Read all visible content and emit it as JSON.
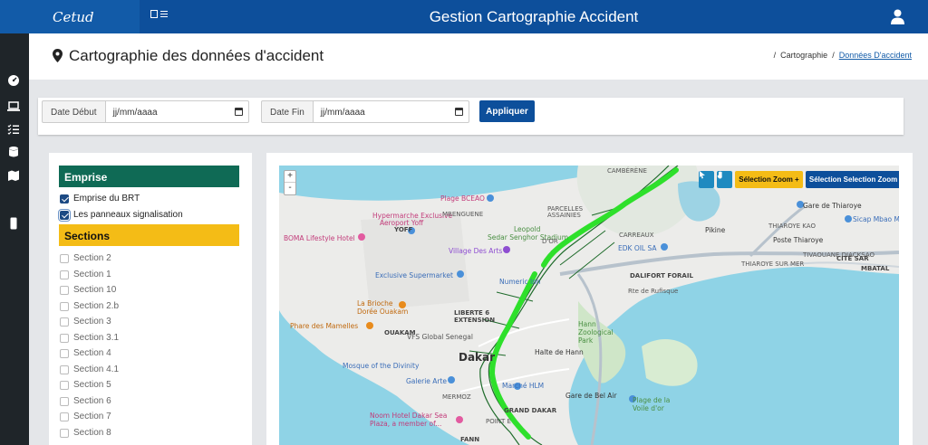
{
  "brand": {
    "logo_text": "Cetud"
  },
  "header": {
    "title": "Gestion Cartographie Accident"
  },
  "icons": {
    "menu": "menu-toggle-icon",
    "user": "user-icon",
    "pin": "map-marker-icon"
  },
  "page": {
    "title": "Cartographie des données d'accident",
    "breadcrumb": {
      "sep1": "/",
      "item1": "Cartographie",
      "sep2": "/",
      "item2": "Données D'accident"
    }
  },
  "sidebar_icons": [
    "dashboard-icon",
    "laptop-icon",
    "tasks-icon",
    "database-icon",
    "map-icon",
    "mobile-icon"
  ],
  "filters": {
    "start_label": "Date Début",
    "start_value": "jj/mm/aaaa",
    "end_label": "Date Fin",
    "end_value": "jj/mm/aaaa",
    "apply": "Appliquer"
  },
  "layers": {
    "emprise_header": "Emprise",
    "emprise_items": [
      {
        "label": "Emprise du BRT",
        "checked": true
      },
      {
        "label": "Les panneaux signalisation",
        "checked": true
      }
    ],
    "sections_header": "Sections",
    "sections": [
      "Section 2",
      "Section 1",
      "Section 10",
      "Section 2.b",
      "Section 3",
      "Section 3.1",
      "Section 4",
      "Section 4.1",
      "Section 5",
      "Section 6",
      "Section 7",
      "Section 8"
    ]
  },
  "map": {
    "zoom_in": "+",
    "zoom_out": "-",
    "btn_zoom_in": "Sélection Zoom +",
    "btn_zoom_out": "Sélection Selection Zoom -",
    "labels": {
      "cambere": "CAMBÉRÈNE",
      "boceao": "Plage BCEAO",
      "hypermarche": "Hypermarche Exclusive",
      "aeroport": "Aeroport Yoff",
      "mbengue": "MBENGUENE",
      "parcelles": "PARCELLES",
      "assainies": "ASSAINIES",
      "leopold": "Leopold",
      "sedar": "Sedar Senghor Stadium",
      "boma": "BOMA Lifestyle Hotel",
      "yoff": "YOFF",
      "village": "Village Des Arts",
      "dor": "D'OR",
      "carreaux": "CARREAUX",
      "edk": "EDK OIL SA",
      "exclusive": "Exclusive Supermarket",
      "dalifort": "DALIFORT FORAIL",
      "nuances": "Numeric Inn",
      "brioche": "La Brioche Dorée Ouakam",
      "phare": "Phare des Mamelles",
      "liberte": "LIBERTE 6 EXTENSION",
      "hann": "Hann Zoological Park",
      "vfs": "VFS Global Senegal",
      "ouakam": "OUAKAM",
      "halte": "Halte de Hann",
      "mosque": "Mosque of the Divinity",
      "dakar": "Dakar",
      "galerie": "Galerie Arte",
      "hlm": "Marché HLM",
      "gare_bel": "Gare de Bel Air",
      "plage_voile": "Plage de la Voile d'or",
      "noom": "Noom Hotel Dakar Sea Plaza, a member of...",
      "grand_dakar": "GRAND DAKAR",
      "fann": "FANN",
      "point_e": "POINT E",
      "mermoz": "MERMOZ",
      "thiaroye_gare": "Gare de Thiaroye",
      "sicap": "Sicap Mbao M",
      "pikine": "Pikine",
      "poste_thiaroye": "Poste Thiaroye",
      "thiaroye_azur": "THIAROYE SUR MER",
      "cite_sar": "CITÉ SAR",
      "mbatal": "MBATAL",
      "tiaroye_kao": "THIAROYE KAO",
      "tivaouane": "TIVAOUANE DIACKSAO",
      "route": "Rte de Rufisque"
    }
  }
}
